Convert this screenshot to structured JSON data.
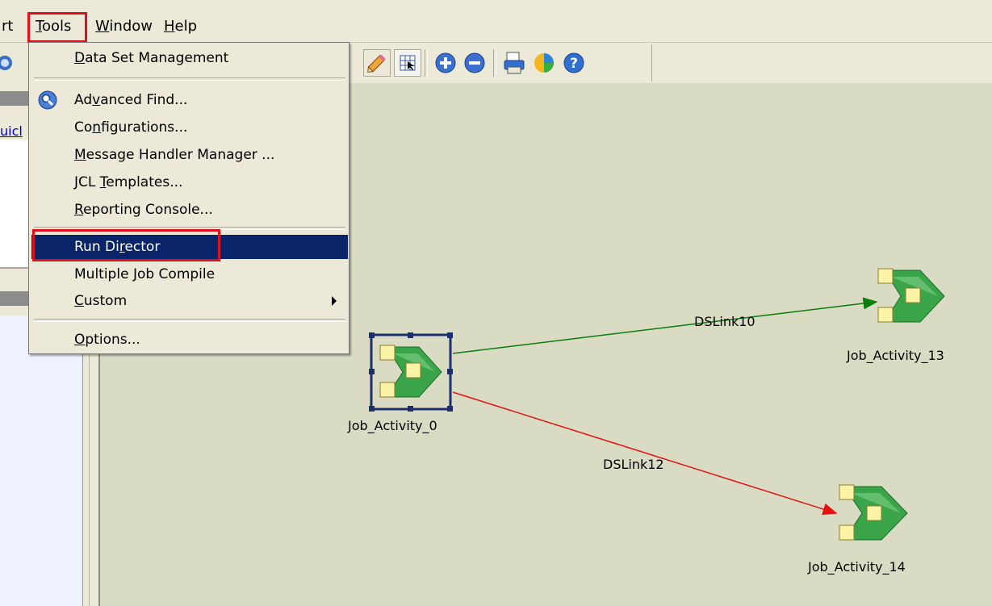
{
  "menubar": {
    "partial_item": "rt",
    "tools": "Tools",
    "window": "Window",
    "help": "Help"
  },
  "left_panel": {
    "quick_link": "uicl"
  },
  "tools_menu": {
    "items": [
      {
        "label": "Data Set Management"
      },
      {
        "label": "Advanced Find..."
      },
      {
        "label": "Configurations..."
      },
      {
        "label": "Message Handler Manager ..."
      },
      {
        "label": "JCL Templates..."
      },
      {
        "label": "Reporting Console..."
      },
      {
        "label": "Run Director"
      },
      {
        "label": "Multiple Job Compile"
      },
      {
        "label": "Custom"
      },
      {
        "label": "Options..."
      }
    ]
  },
  "toolbar": {
    "icons": [
      "pencil-icon",
      "snap-grid-icon",
      "zoom-in-icon",
      "zoom-out-icon",
      "print-icon",
      "report-pie-icon",
      "help-icon"
    ]
  },
  "diagram": {
    "nodes": [
      {
        "label": "Job_Activity_0"
      },
      {
        "label": "Job_Activity_13"
      },
      {
        "label": "Job_Activity_14"
      }
    ],
    "links": [
      {
        "label": "DSLink10",
        "color": "#0a7d0a"
      },
      {
        "label": "DSLink12",
        "color": "#e41111"
      }
    ]
  },
  "colors": {
    "highlight": "#e0111b",
    "menu_selected": "#0a246a",
    "canvas": "#d9dcc3"
  }
}
